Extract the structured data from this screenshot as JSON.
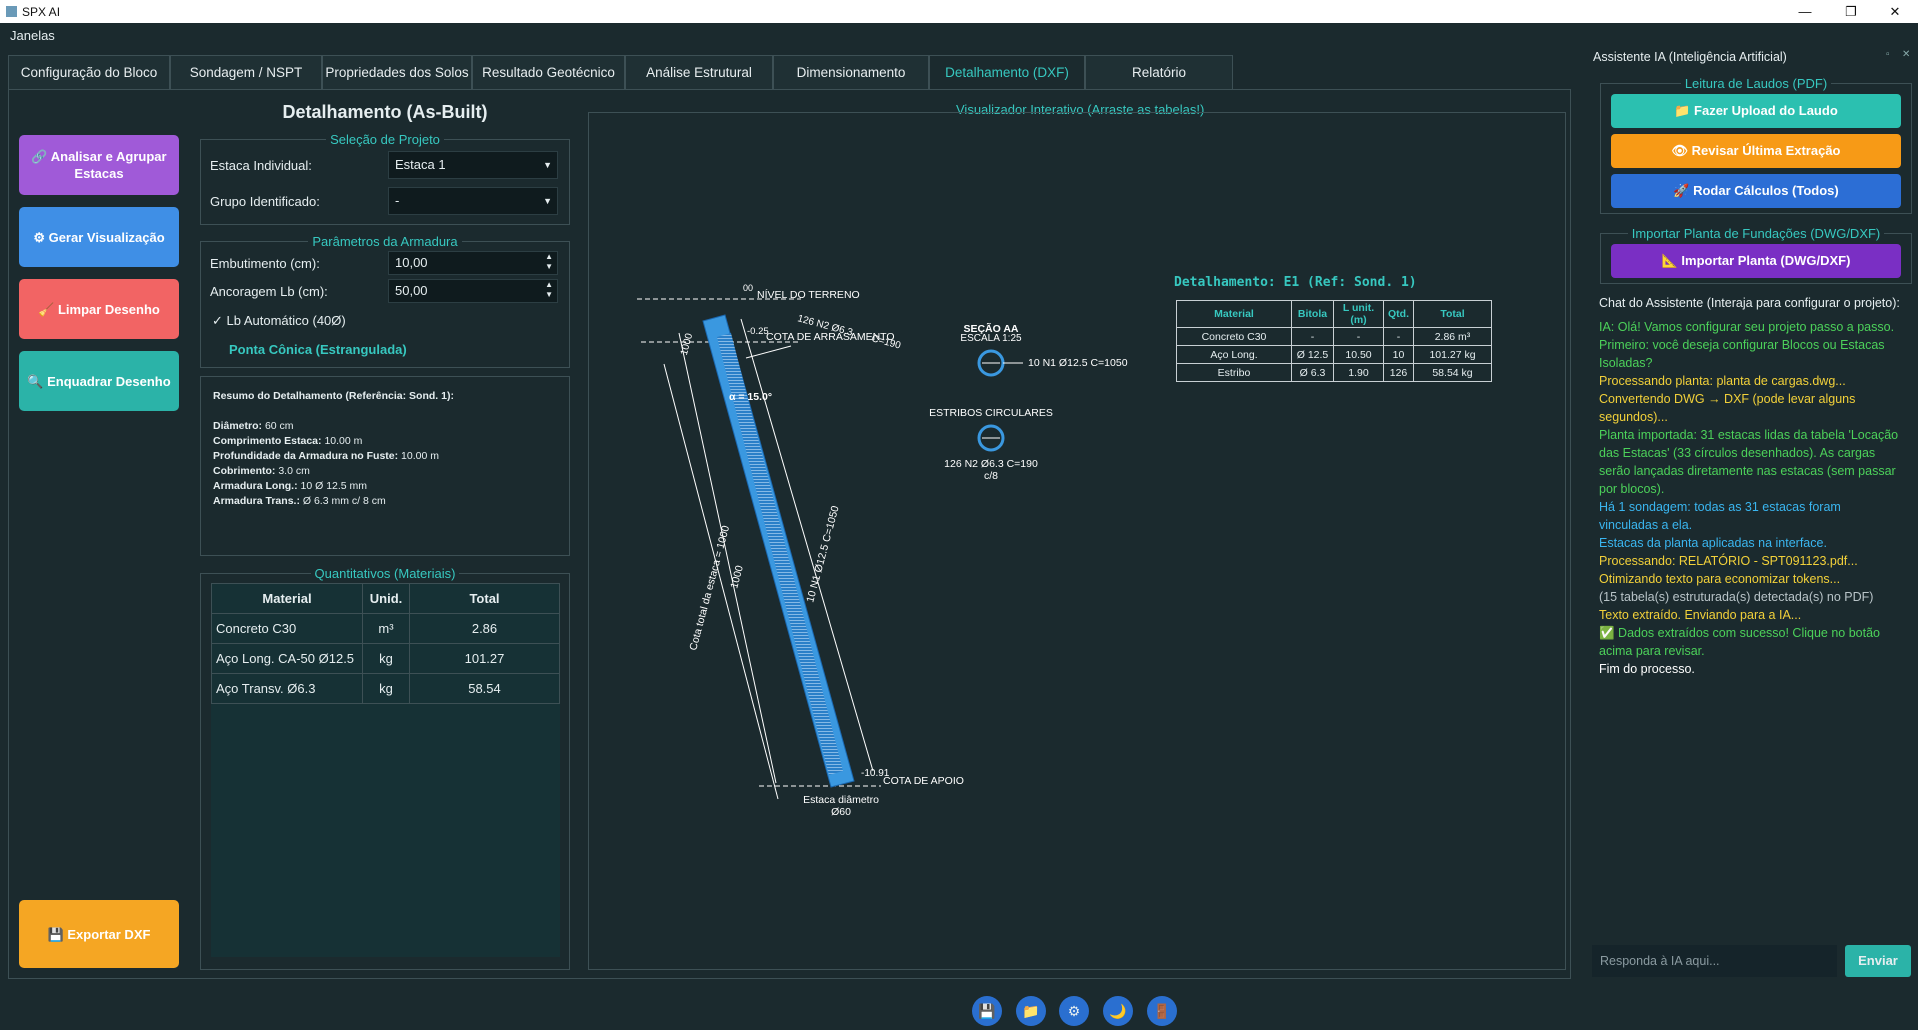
{
  "window": {
    "title": "SPX AI",
    "menu": "Janelas"
  },
  "tabs": [
    "Configuração do Bloco",
    "Sondagem / NSPT",
    "Propriedades dos Solos",
    "Resultado Geotécnico",
    "Análise Estrutural",
    "Dimensionamento",
    "Detalhamento (DXF)",
    "Relatório"
  ],
  "left_buttons": {
    "analisar": "🔗 Analisar e Agrupar Estacas",
    "gerar": "⚙ Gerar Visualização",
    "limpar": "🧹 Limpar Desenho",
    "enquadrar": "🔍 Enquadrar Desenho",
    "exportar": "💾 Exportar DXF"
  },
  "heading": "Detalhamento (As-Built)",
  "selecao": {
    "legend": "Seleção de Projeto",
    "estaca_label": "Estaca Individual:",
    "estaca_value": "Estaca 1",
    "grupo_label": "Grupo Identificado:",
    "grupo_value": "-"
  },
  "armadura": {
    "legend": "Parâmetros da Armadura",
    "emb_label": "Embutimento (cm):",
    "emb_value": "10,00",
    "anc_label": "Ancoragem Lb (cm):",
    "anc_value": "50,00",
    "lb_auto": "✓  Lb Automático (40Ø)",
    "ponta": "Ponta Cônica (Estrangulada)"
  },
  "resumo": {
    "title": "Resumo do Detalhamento (Referência: Sond. 1):",
    "rows": [
      [
        "Diâmetro:",
        "60 cm"
      ],
      [
        "Comprimento Estaca:",
        "10.00 m"
      ],
      [
        "Profundidade da Armadura no Fuste:",
        "10.00 m"
      ],
      [
        "Cobrimento:",
        "3.0 cm"
      ],
      [
        "Armadura Long.:",
        "10 Ø 12.5 mm"
      ],
      [
        "Armadura Trans.:",
        "Ø 6.3 mm c/ 8 cm"
      ]
    ]
  },
  "quantitativos": {
    "legend": "Quantitativos (Materiais)",
    "headers": [
      "Material",
      "Unid.",
      "Total"
    ],
    "rows": [
      [
        "Concreto C30",
        "m³",
        "2.86"
      ],
      [
        "Aço Long. CA-50 Ø12.5",
        "kg",
        "101.27"
      ],
      [
        "Aço Transv. Ø6.3",
        "kg",
        "58.54"
      ]
    ]
  },
  "viewer": {
    "title": "Visualizador Interativo (Arraste as tabelas!)",
    "labels": {
      "terreno_val": "00",
      "terreno": "NÍVEL DO TERRENO",
      "arras_val": "-0.25",
      "arras": "COTA DE ARRASAMENTO",
      "n2": "126 N2 Ø6.3",
      "n2c": "C=190",
      "r1000": "1000",
      "alpha": "α = 15.0°",
      "cota_total": "Cota total da estaca = 1000",
      "c1000": "1000",
      "n1": "10 N1 Ø12.5 C=1050",
      "apoio_val": "-10.91",
      "apoio": "COTA DE APOIO",
      "diam1": "Estaca diâmetro",
      "diam2": "Ø60",
      "secao": "SEÇÃO AA",
      "escala": "ESCALA 1:25",
      "sec_n1": "10 N1 Ø12.5 C=1050",
      "estribos": "ESTRIBOS CIRCULARES",
      "est1": "126 N2 Ø6.3 C=190",
      "est2": "c/8"
    },
    "table_title": "Detalhamento: E1 (Ref: Sond. 1)",
    "table_headers": [
      "Material",
      "Bitola",
      "L unit.(m)",
      "Qtd.",
      "Total"
    ],
    "table_rows": [
      [
        "Concreto C30",
        "-",
        "-",
        "-",
        "2.86 m³"
      ],
      [
        "Aço Long.",
        "Ø 12.5",
        "10.50",
        "10",
        "101.27 kg"
      ],
      [
        "Estribo",
        "Ø 6.3",
        "1.90",
        "126",
        "58.54 kg"
      ]
    ]
  },
  "assistant": {
    "title": "Assistente IA (Inteligência Artificial)",
    "leitura_legend": "Leitura de Laudos (PDF)",
    "upload": "📁 Fazer Upload do Laudo",
    "revisar": "👁 Revisar Última Extração",
    "rodar": "🚀 Rodar Cálculos (Todos)",
    "importar_legend": "Importar Planta de Fundações (DWG/DXF)",
    "importar": "📐 Importar Planta (DWG/DXF)",
    "chat_label": "Chat do Assistente (Interaja para configurar o projeto):",
    "messages": [
      {
        "text": "IA: Olá! Vamos configurar seu projeto passo a passo. Primeiro: você deseja configurar Blocos ou Estacas Isoladas?",
        "color": "#4cd15a"
      },
      {
        "text": "Processando planta: planta de cargas.dwg...",
        "color": "#f2d13a"
      },
      {
        "text": "Convertendo DWG → DXF (pode levar alguns segundos)...",
        "color": "#f2d13a"
      },
      {
        "text": "Planta importada: 31 estacas lidas da tabela 'Locação das Estacas' (33 círculos desenhados). As cargas serão lançadas diretamente nas estacas (sem passar por blocos).",
        "color": "#4cd15a"
      },
      {
        "text": "Há 1 sondagem: todas as 31 estacas foram vinculadas a ela.",
        "color": "#3ab6f0"
      },
      {
        "text": "Estacas da planta aplicadas na interface.",
        "color": "#3ab6f0"
      },
      {
        "text": "Processando: RELATÓRIO - SPT091123.pdf...",
        "color": "#f2d13a"
      },
      {
        "text": "Otimizando texto para economizar tokens...",
        "color": "#f2d13a"
      },
      {
        "text": "(15 tabela(s) estruturada(s) detectada(s) no PDF)",
        "color": "#b9c4c8"
      },
      {
        "text": "Texto extraído. Enviando para a IA...",
        "color": "#f2d13a"
      },
      {
        "text": "✅ Dados extraídos com sucesso! Clique no botão acima para revisar.",
        "color": "#4cd15a"
      },
      {
        "text": "Fim do processo.",
        "color": "#ffffff"
      }
    ],
    "input_placeholder": "Responda à IA aqui...",
    "send": "Enviar"
  },
  "colors": {
    "accent": "#37c8c0",
    "purple": "#a05ad8",
    "blue": "#3f8fe6",
    "red": "#f26464",
    "teal": "#2bb3a8",
    "orange": "#f5a623"
  }
}
